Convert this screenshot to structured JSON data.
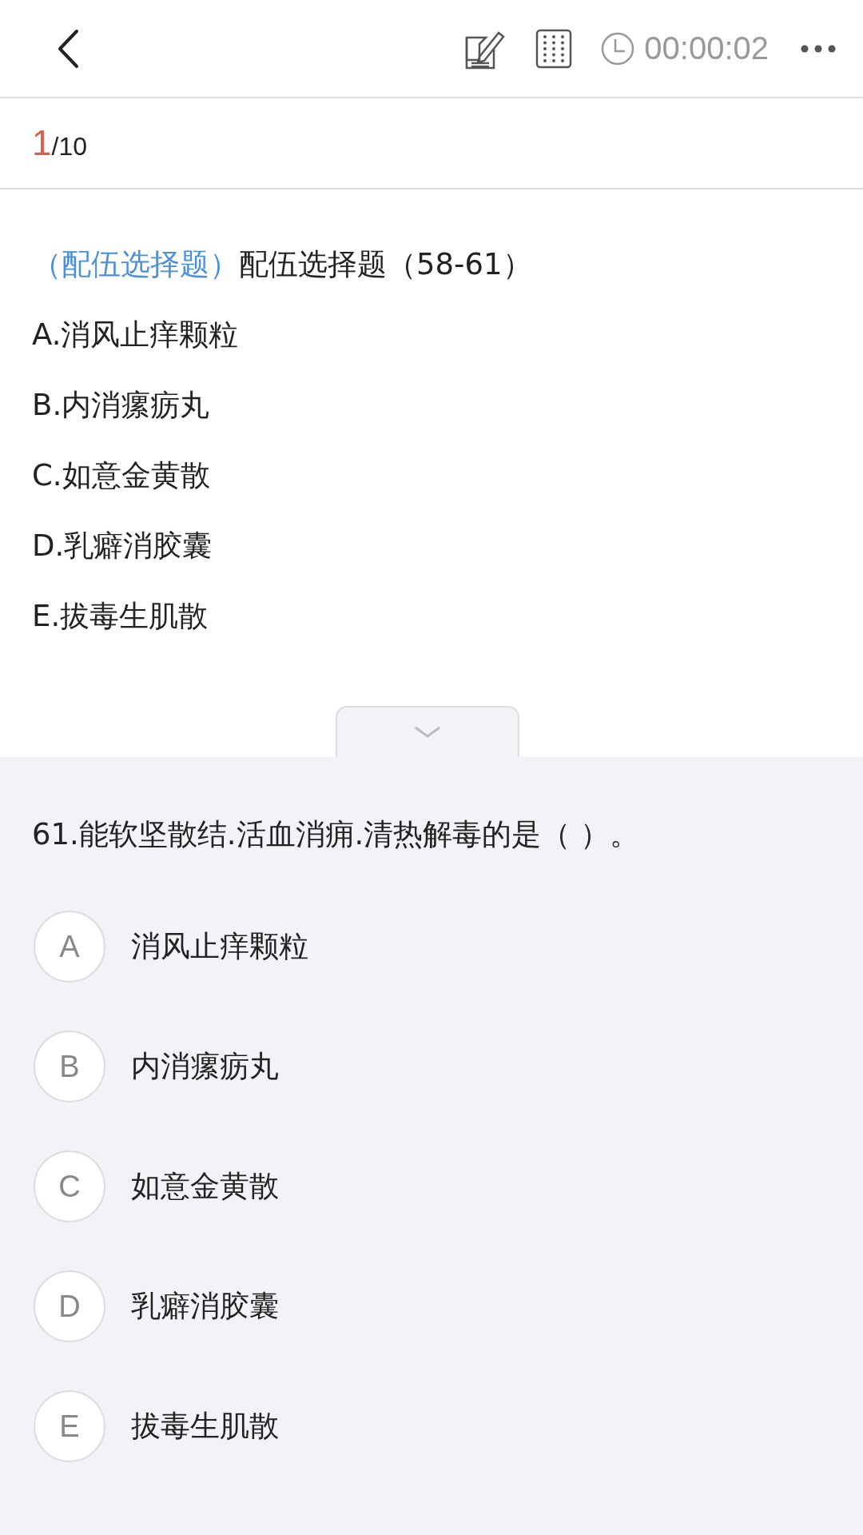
{
  "header": {
    "timer": "00:00:02"
  },
  "progress": {
    "current": "1",
    "total": "/10"
  },
  "material": {
    "tag": "（配伍选择题）",
    "title": "配伍选择题（58-61）",
    "options": [
      "A.消风止痒颗粒",
      "B.内消瘰疬丸",
      "C.如意金黄散",
      "D.乳癖消胶囊",
      "E.拔毒生肌散"
    ]
  },
  "question": {
    "text": "61.能软坚散结.活血消痈.清热解毒的是（ ）。",
    "options": [
      {
        "letter": "A",
        "text": "消风止痒颗粒",
        "selected": false
      },
      {
        "letter": "B",
        "text": "内消瘰疬丸",
        "selected": false
      },
      {
        "letter": "C",
        "text": "如意金黄散",
        "selected": false
      },
      {
        "letter": "D",
        "text": "乳癖消胶囊",
        "selected": false
      },
      {
        "letter": "E",
        "text": "拔毒生肌散",
        "selected": false
      }
    ]
  }
}
